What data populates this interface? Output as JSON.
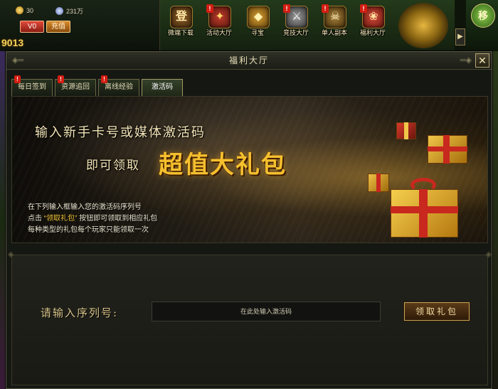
{
  "hud": {
    "gold_value": "30",
    "coupon_value": "231万",
    "vip_label": "V0",
    "recharge_label": "充值",
    "power_value": "9013",
    "icons": [
      {
        "label": "微端下载",
        "glyph": "登",
        "alert": false
      },
      {
        "label": "活动大厅",
        "glyph": "✦",
        "alert": true
      },
      {
        "label": "寻宝",
        "glyph": "◆",
        "alert": false
      },
      {
        "label": "竞技大厅",
        "glyph": "⚔",
        "alert": true
      },
      {
        "label": "单人副本",
        "glyph": "☠",
        "alert": true
      },
      {
        "label": "福利大厅",
        "glyph": "❀",
        "alert": true
      }
    ],
    "side_button_glyph": "移",
    "alert_mark": "!"
  },
  "panel": {
    "title": "福利大厅",
    "close_glyph": "✕",
    "tabs": [
      {
        "label": "每日签到",
        "alert": true,
        "active": false
      },
      {
        "label": "资源追回",
        "alert": true,
        "active": false
      },
      {
        "label": "离线经验",
        "alert": true,
        "active": false
      },
      {
        "label": "激活码",
        "alert": false,
        "active": true
      }
    ]
  },
  "banner": {
    "line1": "输入新手卡号或媒体激活码",
    "line2_prefix": "即可领取",
    "line2_highlight": "超值大礼包",
    "rules": {
      "line1": "在下列输入框输入您的激活码序列号",
      "line2_prefix": "点击",
      "line2_highlight": "“领取礼包”",
      "line2_suffix": "按钮即可领取到相应礼包",
      "line3": "每种类型的礼包每个玩家只能领取一次"
    }
  },
  "redeem": {
    "label": "请输入序列号:",
    "placeholder": "在此处输入激活码",
    "button_label": "领取礼包"
  }
}
